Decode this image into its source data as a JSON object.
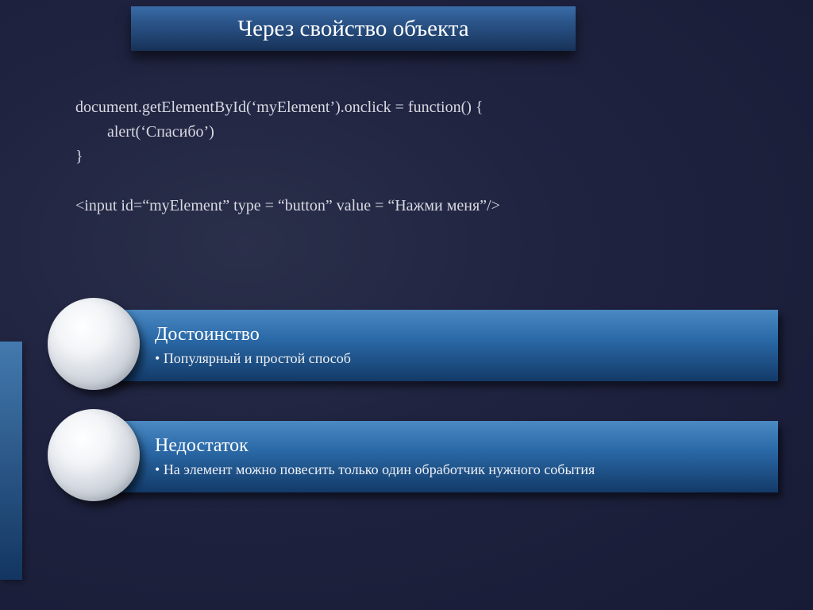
{
  "title": "Через свойство объекта",
  "code": "document.getElementById(‘myElement’).onclick = function() {\n        alert(‘Спасибо’)\n}\n\n<input id=“myElement” type = “button” value = “Нажми меня”/>",
  "banners": [
    {
      "heading": "Достоинство",
      "bullet": "Популярный и простой способ"
    },
    {
      "heading": "Недостаток",
      "bullet": "На элемент можно повесить только  один обработчик нужного события"
    }
  ]
}
